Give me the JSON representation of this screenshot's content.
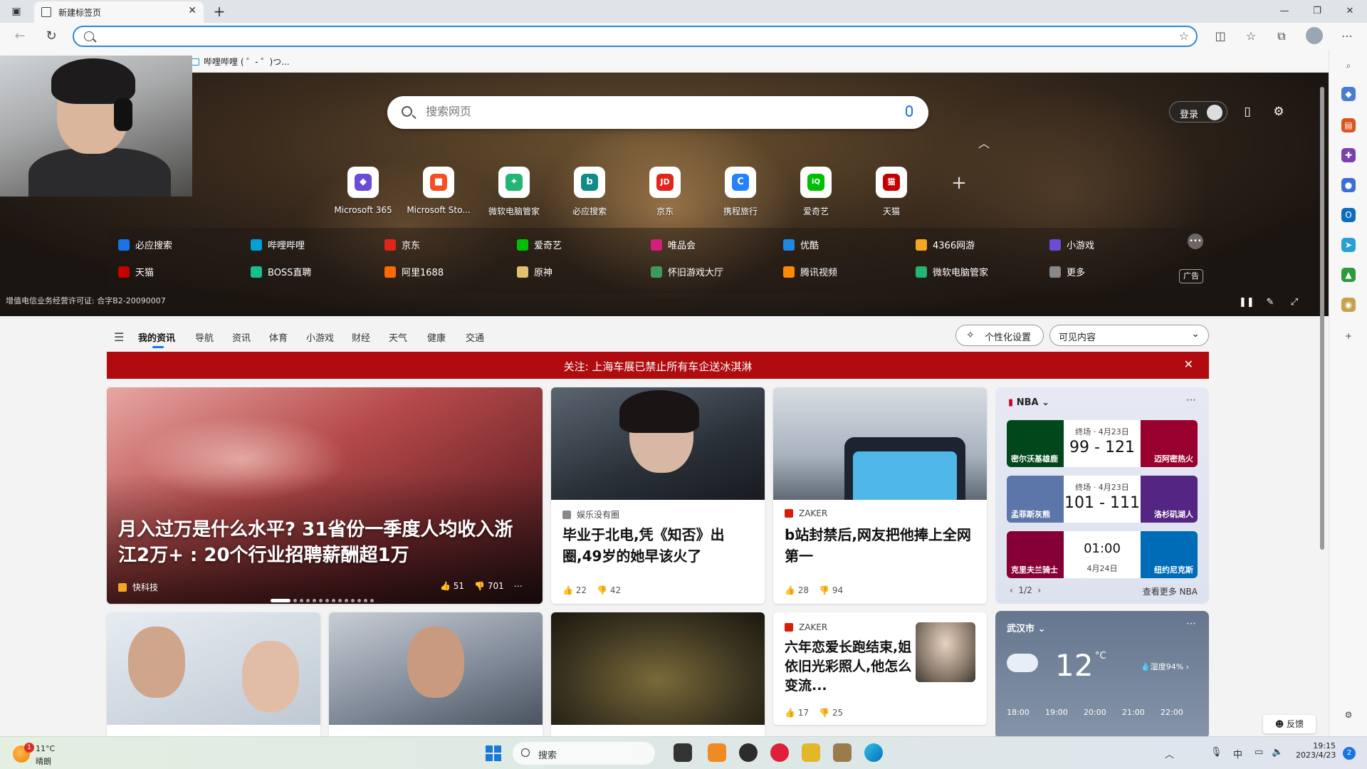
{
  "browser": {
    "tab_title": "新建标签页",
    "new_tab": "+",
    "address_value": "",
    "favorites": [
      {
        "label": "哔哩哔哩 ( ゜- ゜)つ..."
      }
    ]
  },
  "hero": {
    "search_placeholder": "搜索网页",
    "login_label": "登录",
    "tiles": [
      {
        "label": "Microsoft 365",
        "color": "#6a4cd8",
        "glyph": "◆"
      },
      {
        "label": "Microsoft Sto...",
        "color": "#f25022",
        "glyph": "■"
      },
      {
        "label": "微软电脑管家",
        "color": "#22b573",
        "glyph": "✦"
      },
      {
        "label": "必应搜索",
        "color": "#138a8a",
        "glyph": "b"
      },
      {
        "label": "京东",
        "color": "#e1251b",
        "glyph": "JD"
      },
      {
        "label": "携程旅行",
        "color": "#2681ff",
        "glyph": "C"
      },
      {
        "label": "爱奇艺",
        "color": "#00be06",
        "glyph": "iQ"
      },
      {
        "label": "天猫",
        "color": "#c40000",
        "glyph": "猫"
      }
    ],
    "links_row1": [
      {
        "label": "必应搜索",
        "color": "#1a73e8"
      },
      {
        "label": "哔哩哔哩",
        "color": "#00a1d6"
      },
      {
        "label": "京东",
        "color": "#e1251b"
      },
      {
        "label": "爱奇艺",
        "color": "#00be06"
      },
      {
        "label": "唯品会",
        "color": "#d41e7e"
      },
      {
        "label": "优酷",
        "color": "#1e88e5"
      },
      {
        "label": "4366网游",
        "color": "#f5a623"
      },
      {
        "label": "小游戏",
        "color": "#6b4cd8"
      }
    ],
    "links_row2": [
      {
        "label": "天猫",
        "color": "#c40000"
      },
      {
        "label": "BOSS直聘",
        "color": "#14c08b"
      },
      {
        "label": "阿里1688",
        "color": "#ff6a00"
      },
      {
        "label": "原神",
        "color": "#e0c070"
      },
      {
        "label": "怀旧游戏大厅",
        "color": "#3e9a5c"
      },
      {
        "label": "腾讯视频",
        "color": "#ff8a00"
      },
      {
        "label": "微软电脑管家",
        "color": "#22b573"
      },
      {
        "label": "更多",
        "color": "#888888"
      }
    ],
    "ad_badge": "广告",
    "license": "增值电信业务经营许可证: 合字B2-20090007"
  },
  "feed": {
    "nav": [
      "我的资讯",
      "导航",
      "资讯",
      "体育",
      "小游戏",
      "财经",
      "天气",
      "健康",
      "交通"
    ],
    "personalize_label": "个性化设置",
    "visible_content_label": "可见内容",
    "alert": "关注: 上海车展已禁止所有车企送冰淇淋",
    "big_card": {
      "title": "月入过万是什么水平? 31省份一季度人均收入浙江2万+ : 20个行业招聘薪酬超1万",
      "source": "快科技",
      "likes": "51",
      "dislikes": "701"
    },
    "card2": {
      "source": "娱乐没有圈",
      "title": "毕业于北电,凭《知否》出圈,49岁的她早该火了",
      "likes": "22",
      "dislikes": "42"
    },
    "card3": {
      "source": "ZAKER",
      "title": "b站封禁后,网友把他捧上全网第一",
      "likes": "28",
      "dislikes": "94"
    },
    "card4": {
      "source": "ZAKER",
      "title": "六年恋爱长跑结束,姐依旧光彩照人,他怎么变流...",
      "likes": "17",
      "dislikes": "25"
    }
  },
  "nba": {
    "title": "NBA",
    "games": [
      {
        "left": "密尔沃基雄鹿",
        "right": "迈阿密热火",
        "status": "终场 · 4月23日",
        "score": "99 - 121",
        "left_color": "#00471b",
        "right_color": "#98002e"
      },
      {
        "left": "孟菲斯灰熊",
        "right": "洛杉矶湖人",
        "status": "终场 · 4月23日",
        "score": "101 - 111",
        "left_color": "#5d76a9",
        "right_color": "#552583"
      },
      {
        "left": "克里夫兰骑士",
        "right": "纽约尼克斯",
        "status": "4月24日",
        "score": "01:00",
        "left_color": "#860038",
        "right_color": "#006bb6"
      }
    ],
    "pager": "1/2",
    "more": "查看更多 NBA"
  },
  "weather": {
    "city": "武汉市",
    "temp": "12",
    "unit": "°C",
    "humidity": "湿度94%",
    "hours": [
      "18:00",
      "19:00",
      "20:00",
      "21:00",
      "22:00"
    ]
  },
  "feedback": "反馈",
  "taskbar": {
    "weather_temp": "11°C",
    "weather_desc": "晴朗",
    "weather_badge": "1",
    "search_label": "搜索",
    "ime": "中",
    "time": "19:15",
    "date": "2023/4/23",
    "notifications": "2"
  }
}
